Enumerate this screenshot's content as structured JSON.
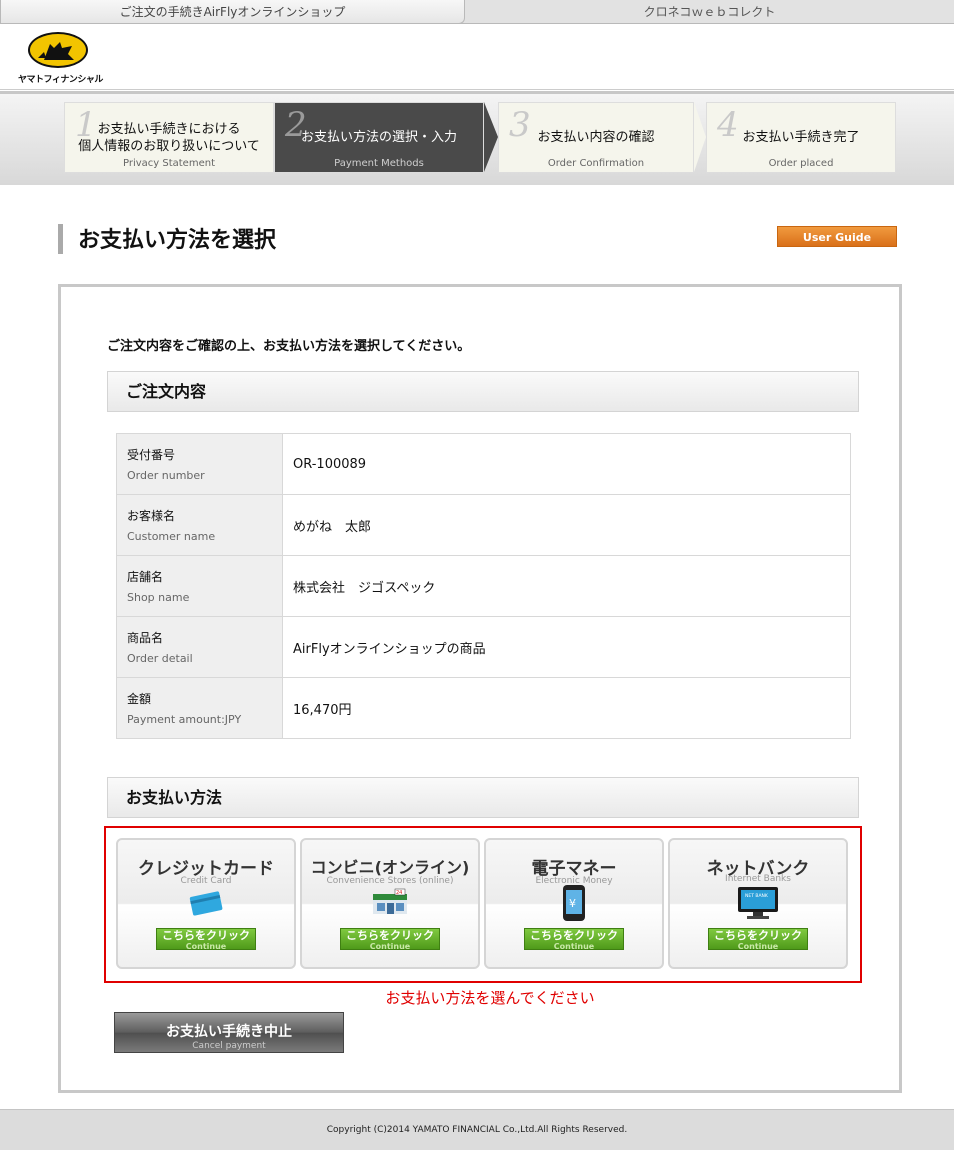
{
  "tabs": {
    "active": "ご注文の手続きAirFlyオンラインショップ",
    "inactive": "クロネコｗｅｂコレクト"
  },
  "logo": {
    "text": "ヤマトフィナンシャル"
  },
  "steps": [
    {
      "num": "1",
      "title1": "お支払い手続きにおける",
      "title2": "個人情報のお取り扱いについて",
      "sub": "Privacy Statement"
    },
    {
      "num": "2",
      "title1": "お支払い方法の選択・入力",
      "sub": "Payment Methods"
    },
    {
      "num": "3",
      "title1": "お支払い内容の確認",
      "sub": "Order Confirmation"
    },
    {
      "num": "4",
      "title1": "お支払い手続き完了",
      "sub": "Order placed"
    }
  ],
  "page_title": "お支払い方法を選択",
  "user_guide": "User Guide (English)",
  "instruction": "ご注文内容をご確認の上、お支払い方法を選択してください。",
  "order_section": "ご注文内容",
  "order_rows": [
    {
      "ja": "受付番号",
      "en": "Order number",
      "value": "OR-100089"
    },
    {
      "ja": "お客様名",
      "en": "Customer name",
      "value": "めがね　太郎"
    },
    {
      "ja": "店舗名",
      "en": "Shop name",
      "value": "株式会社　ジゴスペック"
    },
    {
      "ja": "商品名",
      "en": "Order detail",
      "value": "AirFlyオンラインショップの商品"
    },
    {
      "ja": "金額",
      "en": "Payment amount:JPY",
      "value": "16,470円"
    }
  ],
  "payment_section": "お支払い方法",
  "methods": [
    {
      "title": "クレジットカード",
      "sub": "Credit Card",
      "icon": "credit-card-icon",
      "button": "こちらをクリック",
      "cont": "Continue"
    },
    {
      "title": "コンビニ(オンライン)",
      "sub": "Convenience Stores  (online)",
      "icon": "convenience-store-icon",
      "button": "こちらをクリック",
      "cont": "Continue"
    },
    {
      "title": "電子マネー",
      "sub": "Electronic Money",
      "icon": "mobile-phone-icon",
      "button": "こちらをクリック",
      "cont": "Continue"
    },
    {
      "title": "ネットバンク",
      "sub": "Internet Banks",
      "icon": "net-bank-monitor-icon",
      "button": "こちらをクリック",
      "cont": "Continue"
    }
  ],
  "choose_message": "お支払い方法を選んでください",
  "cancel": {
    "title": "お支払い手続き中止",
    "sub": "Cancel payment"
  },
  "footer": "Copyright (C)2014 YAMATO FINANCIAL Co.,Ltd.All Rights Reserved.",
  "colors": {
    "accent_red": "#e00000",
    "orange": "#e07a22",
    "green": "#5aa824"
  }
}
